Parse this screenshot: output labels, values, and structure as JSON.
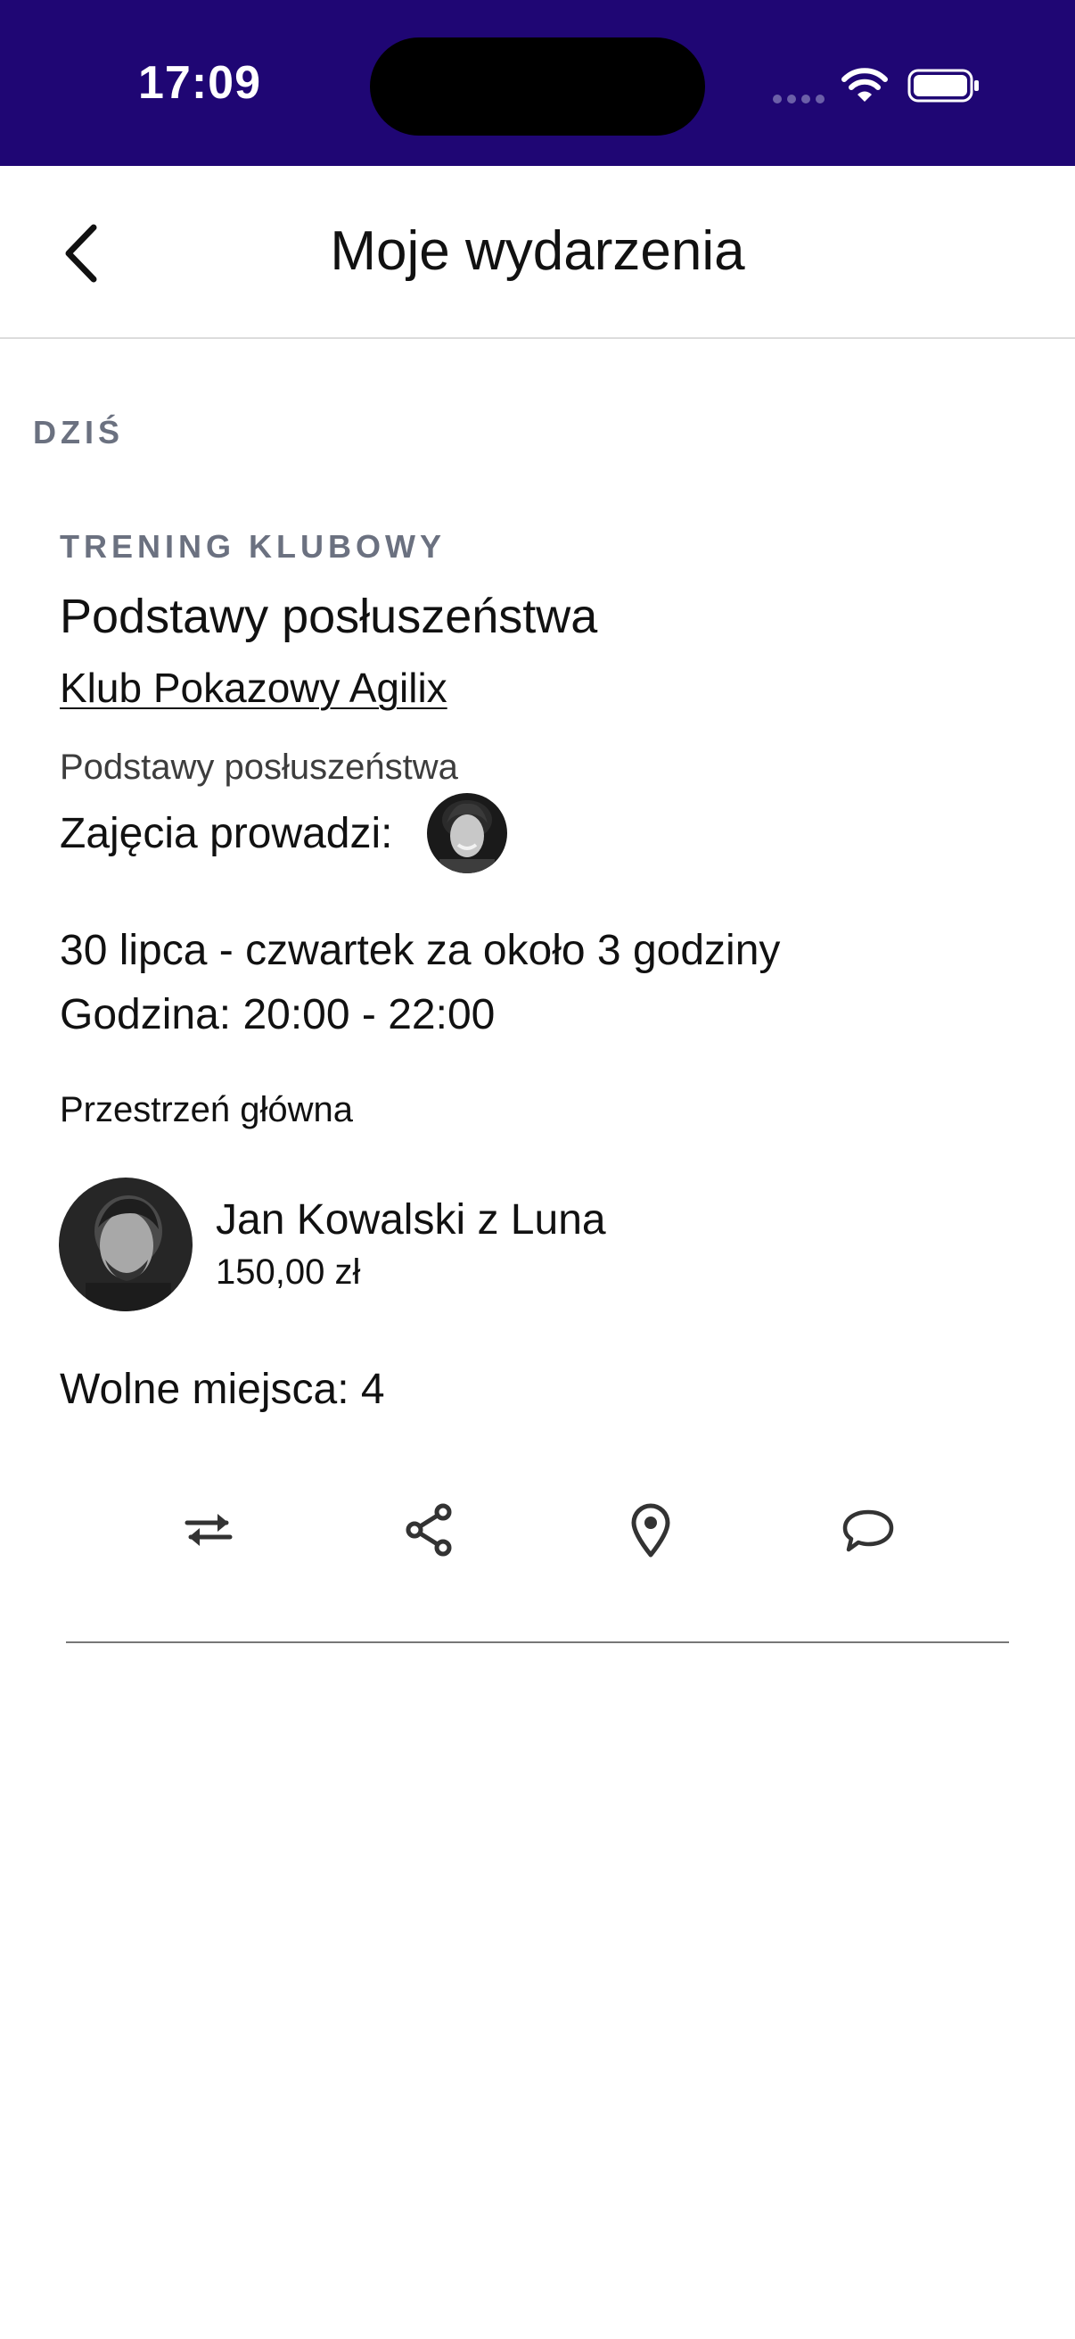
{
  "status_bar": {
    "time": "17:09",
    "background_color": "#1f0674"
  },
  "nav": {
    "title": "Moje wydarzenia",
    "back_icon": "chevron-left-icon"
  },
  "section": {
    "header": "DZIŚ"
  },
  "event": {
    "category": "TRENING KLUBOWY",
    "title": "Podstawy posłuszeństwa",
    "club": "Klub Pokazowy Agilix",
    "subtitle": "Podstawy posłuszeństwa",
    "instructor_label": "Zajęcia prowadzi:",
    "date": "30 lipca - czwartek za około 3 godziny",
    "time": "Godzina: 20:00 - 22:00",
    "space": "Przestrzeń główna",
    "participant": {
      "name": "Jan Kowalski z Luna",
      "price": "150,00 zł"
    },
    "free_spots": "Wolne miejsca: 4",
    "actions": [
      {
        "icon": "swap-arrows-icon"
      },
      {
        "icon": "share-icon"
      },
      {
        "icon": "location-pin-icon"
      },
      {
        "icon": "chat-bubble-icon"
      }
    ]
  }
}
